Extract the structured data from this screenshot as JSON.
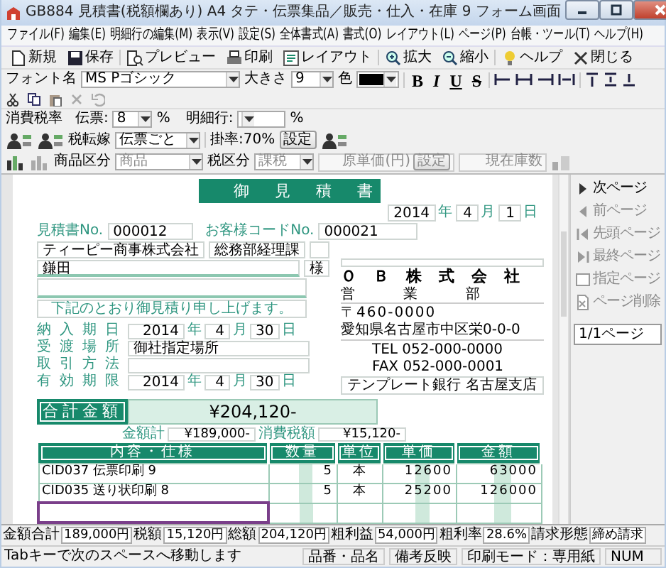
{
  "window": {
    "title": "GB884 見積書(税額欄あり) A4 タテ・伝票集品／販売・仕入・在庫 9 フォーム画面"
  },
  "menu": [
    "ファイル(F)",
    "編集(E)",
    "明細行の編集(M)",
    "表示(V)",
    "設定(S)",
    "全体書式(A)",
    "書式(O)",
    "レイアウト(L)",
    "ページ(P)",
    "台帳・ツール(T)",
    "ヘルプ(H)"
  ],
  "toolbar": [
    {
      "kind": "new",
      "label": "新規"
    },
    {
      "kind": "save",
      "label": "保存"
    },
    {
      "kind": "preview",
      "label": "プレビュー"
    },
    {
      "kind": "print",
      "label": "印刷"
    },
    {
      "kind": "layout",
      "label": "レイアウト"
    },
    {
      "kind": "zoom-in",
      "label": "拡大"
    },
    {
      "kind": "zoom-out",
      "label": "縮小"
    },
    {
      "kind": "help",
      "label": "ヘルプ"
    },
    {
      "kind": "close",
      "label": "閉じる"
    }
  ],
  "format_bar": {
    "font_label": "フォント名",
    "font": "MS Pゴシック",
    "size_label": "大きさ",
    "size": "9",
    "color_label": "色",
    "style_buttons": [
      {
        "kind": "bold",
        "label": "B"
      },
      {
        "kind": "italic",
        "label": "I"
      },
      {
        "kind": "underline",
        "label": "U"
      },
      {
        "kind": "strike",
        "label": "S"
      }
    ]
  },
  "tax_bar": {
    "label": "消費税率",
    "slip_label": "伝票:",
    "slip_rate": "8",
    "slip_unit": "%",
    "line_label": "明細行:",
    "line_unit": "%"
  },
  "row2": {
    "tax_shift_label": "税転嫁",
    "tax_shift": "伝票ごと",
    "rate": "掛率:70%",
    "set_button": "設定"
  },
  "row3": {
    "disabled": true,
    "category_label": "商品区分",
    "category": "商品",
    "tax_label": "税区分",
    "tax": "課税",
    "cost_label": "原単価(円)",
    "cost_button": "設定",
    "stock_label": "現在庫数"
  },
  "document": {
    "title": "御見積書",
    "issue_date": [
      {
        "value": "2014",
        "unit": "年"
      },
      {
        "value": "4",
        "unit": "月"
      },
      {
        "value": "1",
        "unit": "日"
      }
    ],
    "estimate_no": {
      "label": "見積書No.",
      "value": "000012"
    },
    "customer_code": {
      "label": "お客様コードNo.",
      "value": "000021"
    },
    "customer": "ティーピー商事株式会社",
    "department": "総務部経理課",
    "person": "鎌田",
    "honorific": "様",
    "message": "下記のとおり御見積り申し上げます。",
    "terms": [
      {
        "label": "納入期日",
        "kind": "date",
        "parts": [
          {
            "value": "2014",
            "unit": "年"
          },
          {
            "value": "4",
            "unit": "月"
          },
          {
            "value": "30",
            "unit": "日"
          }
        ]
      },
      {
        "label": "受渡場所",
        "kind": "text",
        "value": "御社指定場所"
      },
      {
        "label": "取引方法",
        "kind": "text"
      },
      {
        "label": "有効期限",
        "kind": "date",
        "parts": [
          {
            "value": "2014",
            "unit": "年"
          },
          {
            "value": "4",
            "unit": "月"
          },
          {
            "value": "30",
            "unit": "日"
          }
        ]
      }
    ],
    "company": {
      "name": "ＯＢ株式会社",
      "department": "営業部",
      "zip": "〒460-0000",
      "address": "愛知県名古屋市中区栄0-0-0",
      "tel": "TEL 052-000-0000",
      "fax": "FAX 052-000-0001",
      "bank": "テンプレート銀行 名古屋支店"
    },
    "total": {
      "label": "合計金額",
      "value": "¥204,120-"
    },
    "subtotals": [
      {
        "label": "金額計",
        "value": "¥189,000-"
      },
      {
        "label": "消費税額",
        "value": "¥15,120-"
      }
    ],
    "table": {
      "columns": [
        "内容・仕様",
        "数量",
        "単位",
        "単価",
        "金額"
      ],
      "rows": [
        {
          "cells": [
            "CID037 伝票印刷 9",
            "5",
            "本",
            "12600",
            "63000"
          ],
          "selected": false
        },
        {
          "cells": [
            "CID035 送り状印刷 8",
            "5",
            "本",
            "25200",
            "126000"
          ],
          "selected": false
        },
        {
          "selected": true
        }
      ]
    }
  },
  "side_panel": {
    "buttons": [
      {
        "kind": "next",
        "label": "次ページ",
        "disabled": false
      },
      {
        "kind": "prev",
        "label": "前ページ",
        "disabled": true
      },
      {
        "kind": "first",
        "label": "先頭ページ",
        "disabled": true
      },
      {
        "kind": "last",
        "label": "最終ページ",
        "disabled": true
      },
      {
        "kind": "goto",
        "label": "指定ページ",
        "disabled": true
      },
      {
        "kind": "delete",
        "label": "ページ削除",
        "disabled": true
      }
    ],
    "page": "1/1ページ"
  },
  "totals": [
    {
      "label": "金額合計",
      "value": "189,000円"
    },
    {
      "label": "税額",
      "value": "15,120円"
    },
    {
      "label": "総額",
      "value": "204,120円"
    },
    {
      "label": "粗利益",
      "value": "54,000円"
    },
    {
      "label": "粗利率",
      "value": "28.6%"
    },
    {
      "label": "請求形態",
      "value": "締め請求"
    }
  ],
  "status_bar": [
    "Tabキーで次のスペースへ移動します",
    "品番・品名",
    "備考反映",
    "印刷モード：専用紙",
    "NUM"
  ]
}
